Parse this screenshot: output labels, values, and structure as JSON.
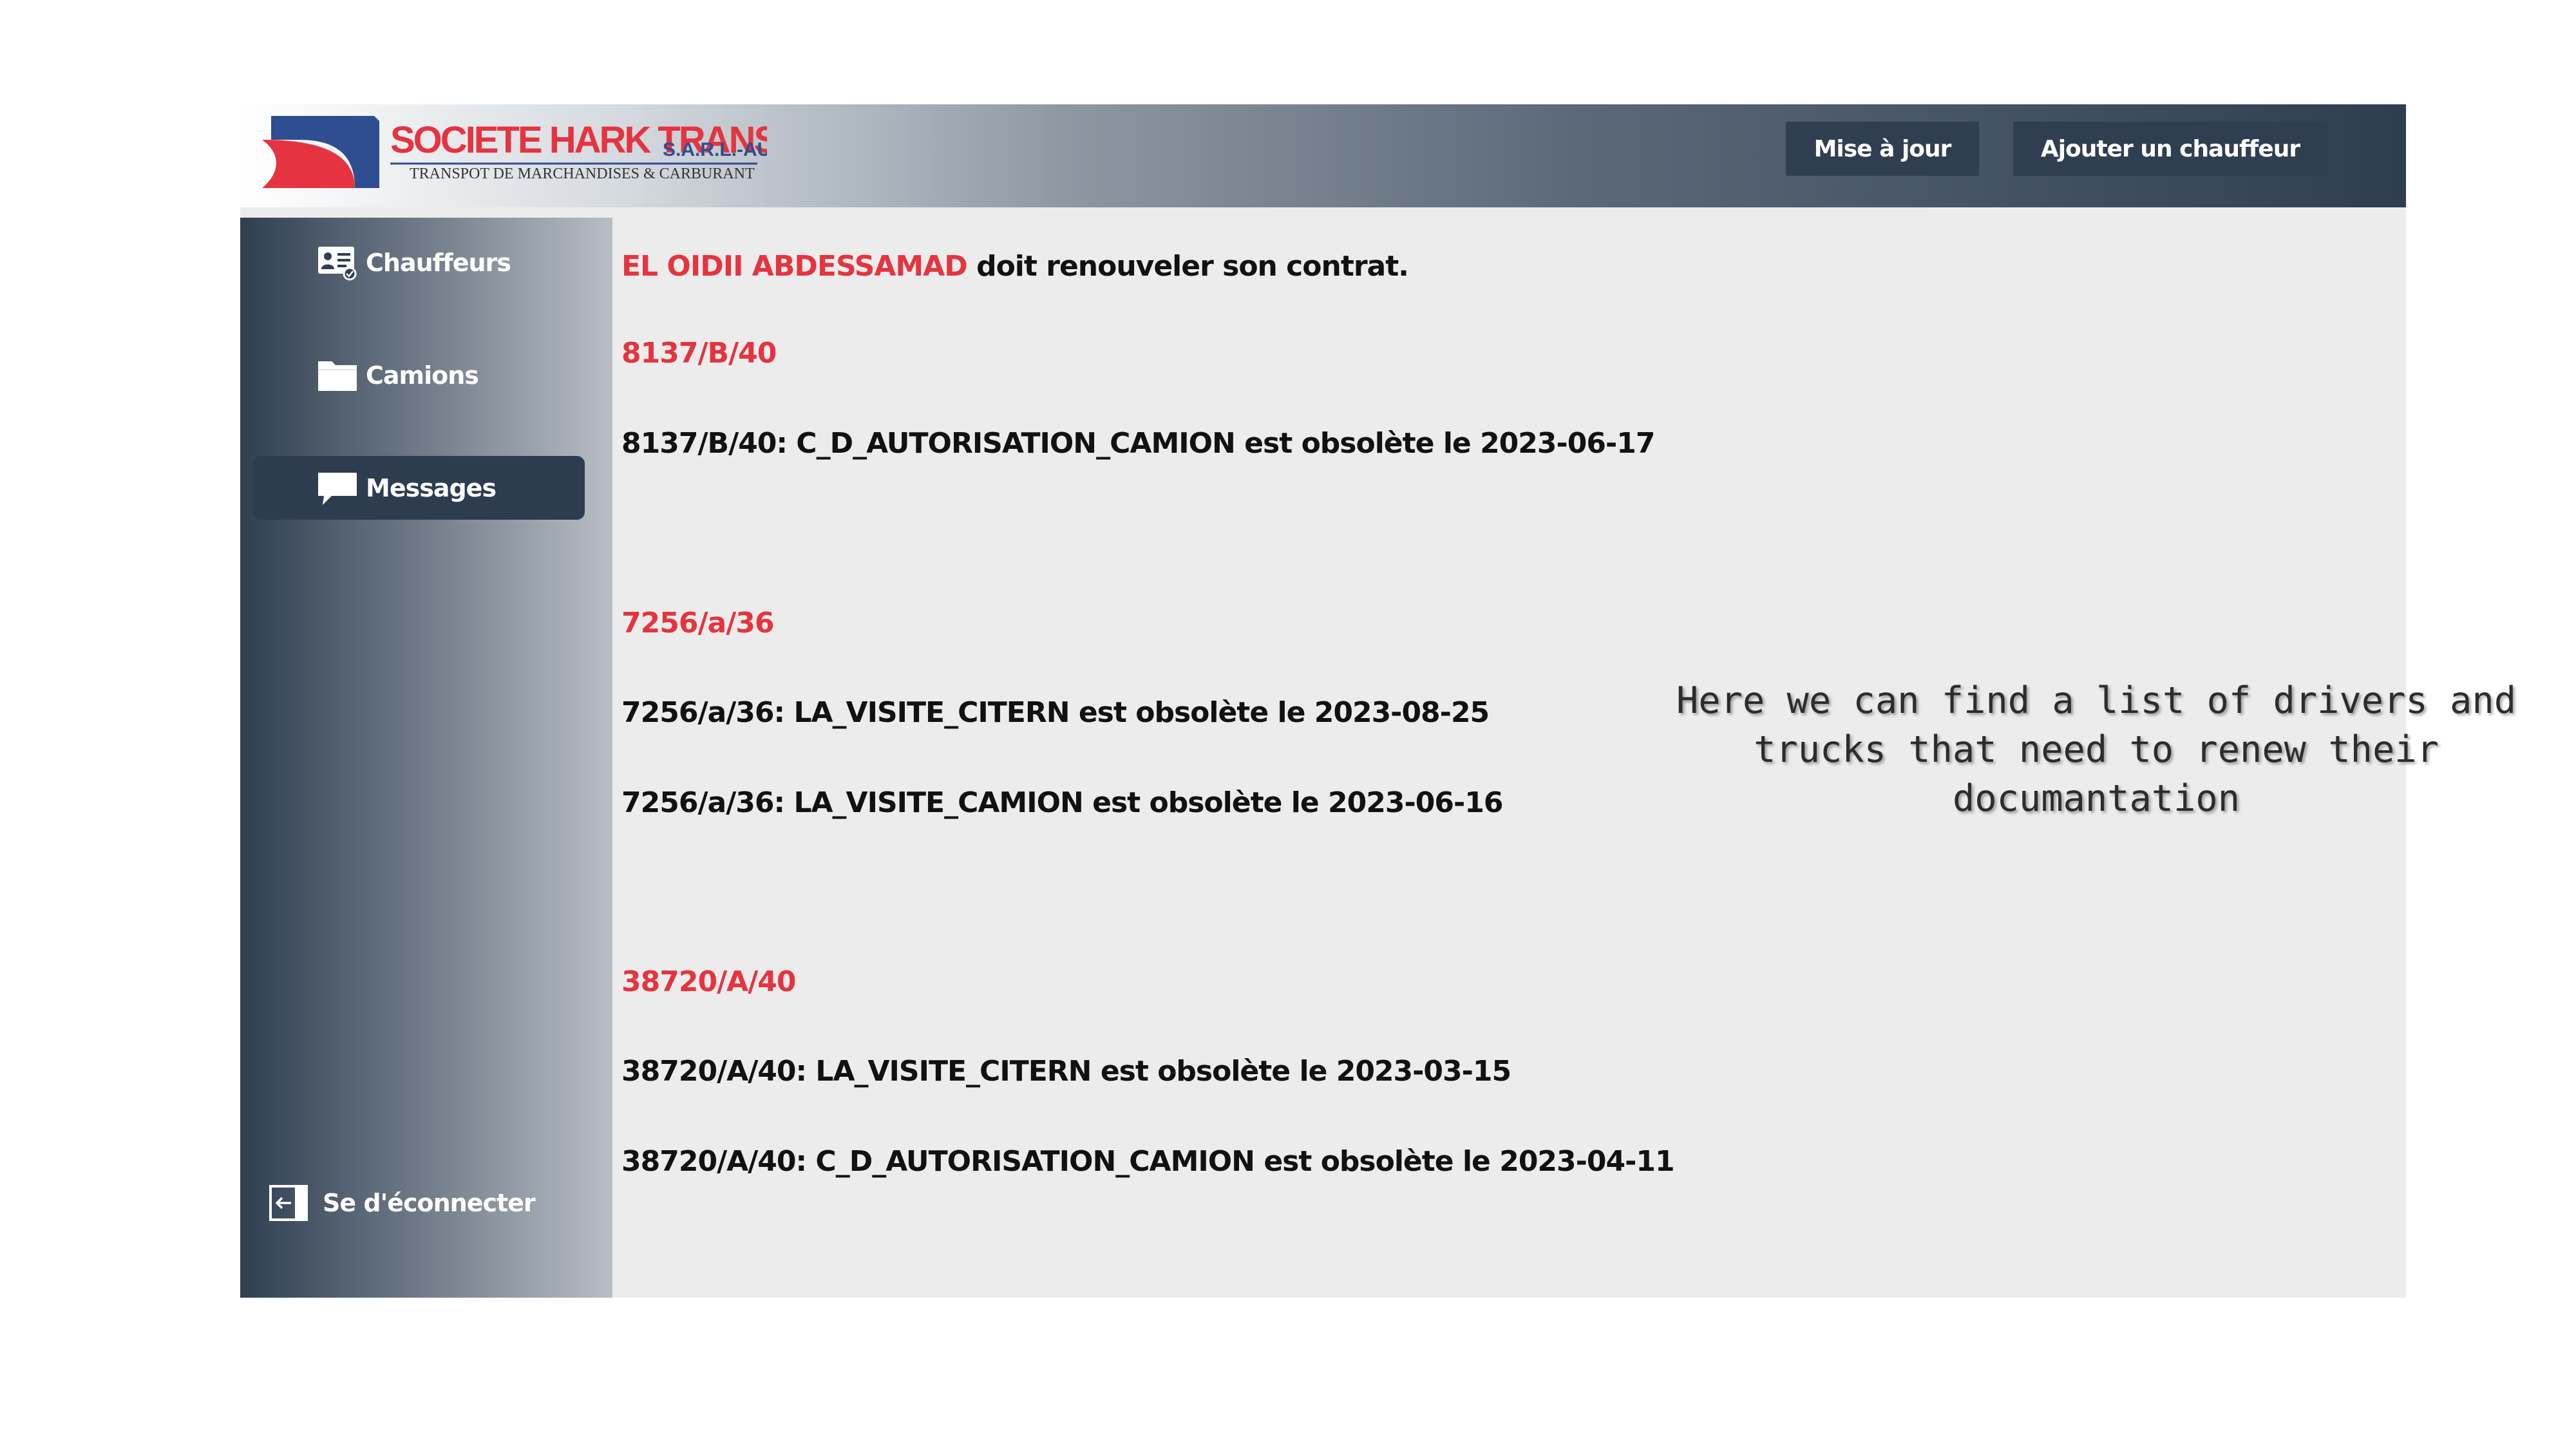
{
  "header": {
    "logo": {
      "name": "SOCIETE HARK TRANS",
      "suffix": "S.A.R.L.-AU",
      "tagline": "TRANSPOT DE MARCHANDISES & CARBURANT"
    },
    "buttons": {
      "update": "Mise à jour",
      "add_driver": "Ajouter un chauffeur"
    }
  },
  "sidebar": {
    "items": [
      {
        "label": "Chauffeurs",
        "icon": "driver-card-icon"
      },
      {
        "label": "Camions",
        "icon": "folder-icon"
      },
      {
        "label": "Messages",
        "icon": "chat-bubble-icon",
        "active": true
      }
    ],
    "logout": {
      "label": "Se d'éconnecter",
      "icon": "logout-icon"
    }
  },
  "messages": {
    "contract": {
      "name": "EL OIDII ABDESSAMAD",
      "text": " doit renouveler son contrat."
    },
    "groups": [
      {
        "plate": "8137/B/40",
        "items": [
          "8137/B/40: C_D_AUTORISATION_CAMION est obsolète le 2023-06-17"
        ]
      },
      {
        "plate": "7256/a/36",
        "items": [
          "7256/a/36: LA_VISITE_CITERN est obsolète le 2023-08-25",
          "7256/a/36: LA_VISITE_CAMION est obsolète le 2023-06-16"
        ]
      },
      {
        "plate": "38720/A/40",
        "items": [
          "38720/A/40: LA_VISITE_CITERN est obsolète le 2023-03-15",
          "38720/A/40: C_D_AUTORISATION_CAMION est obsolète le 2023-04-11"
        ]
      }
    ]
  },
  "annotation": {
    "lines": [
      "Here we can find a list of drivers and",
      "trucks that need to renew their",
      "documantation"
    ]
  },
  "colors": {
    "accent_red": "#e5343f",
    "navy": "#2f3e50",
    "content_bg": "#ececec"
  }
}
